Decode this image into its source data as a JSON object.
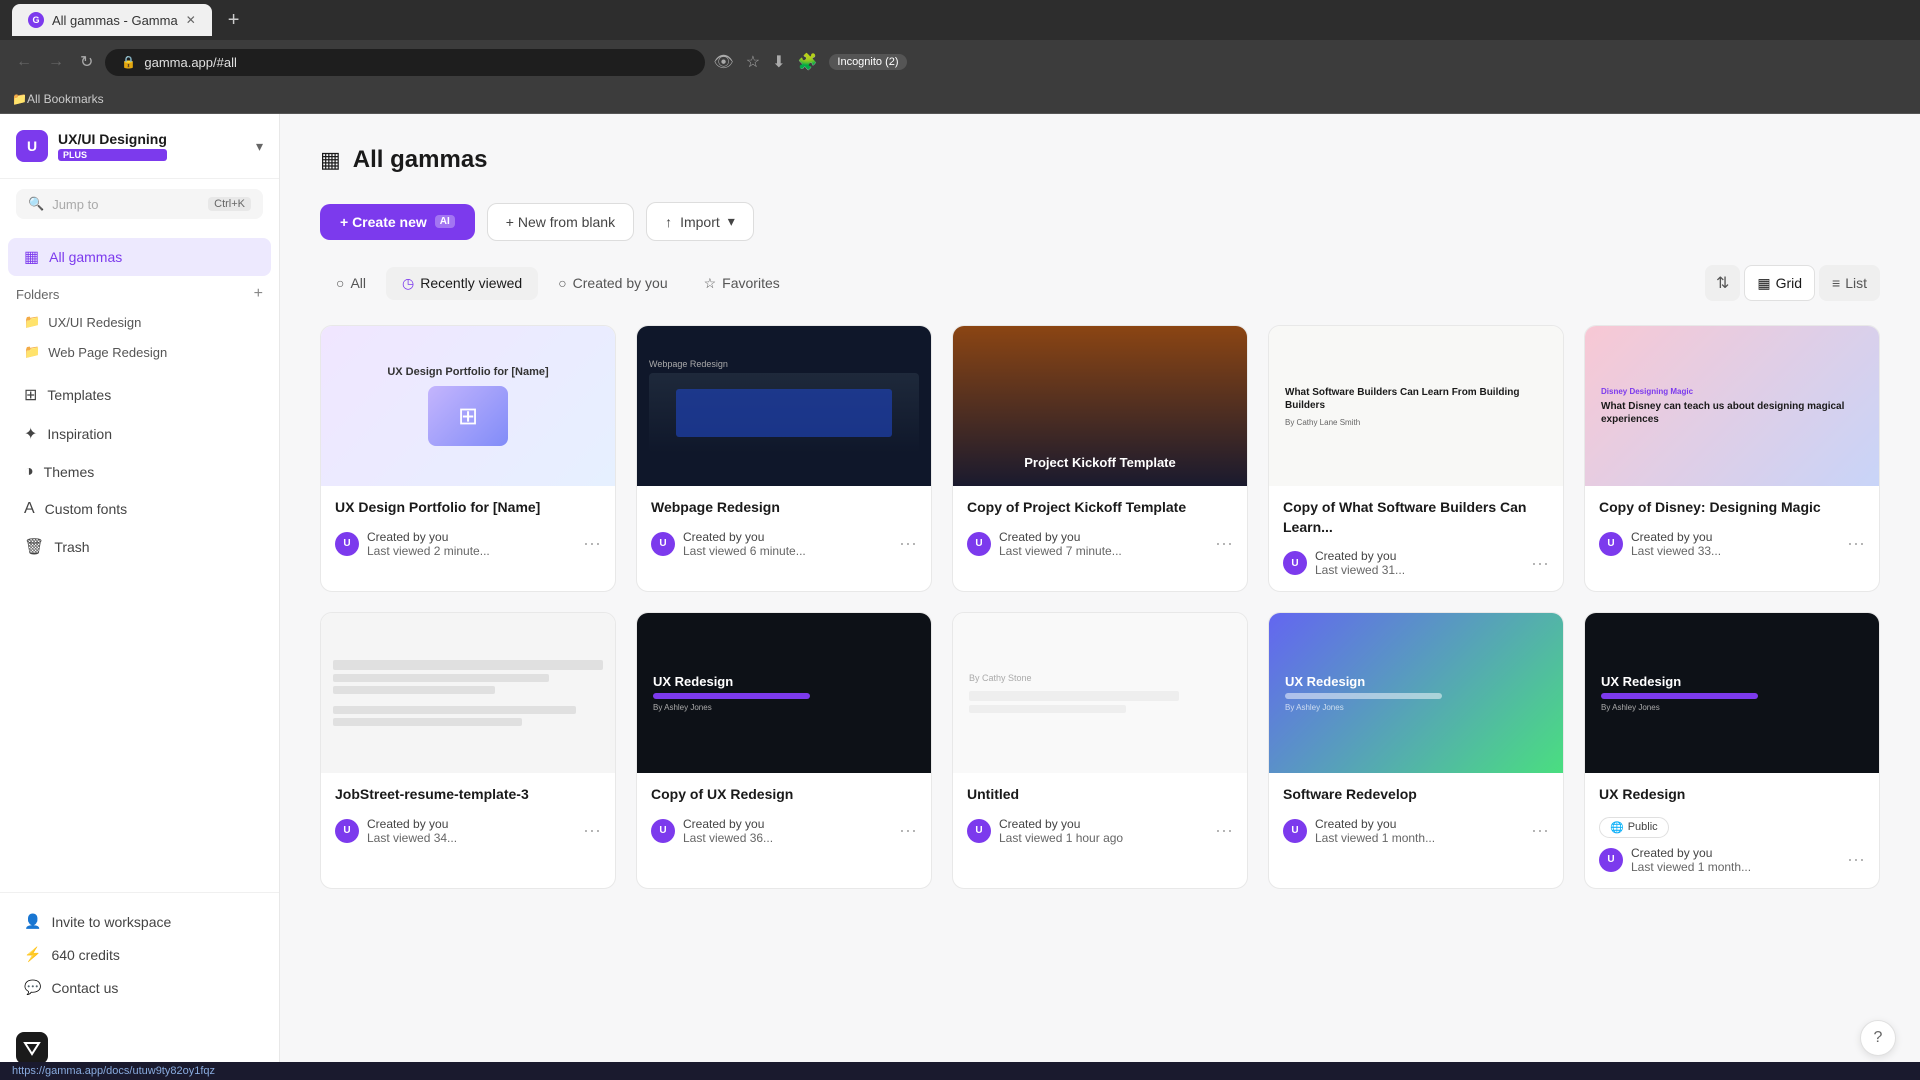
{
  "browser": {
    "tab_title": "All gammas - Gamma",
    "tab_favicon": "G",
    "address": "gamma.app/#all",
    "incognito_label": "Incognito (2)",
    "bookmarks_label": "All Bookmarks"
  },
  "sidebar": {
    "workspace_name": "UX/UI Designing",
    "workspace_initial": "U",
    "workspace_plan": "PLUS",
    "search_placeholder": "Jump to",
    "search_shortcut": "Ctrl+K",
    "nav_items": [
      {
        "label": "All gammas",
        "icon": "▦",
        "active": true
      },
      {
        "label": "Templates",
        "icon": "⊞",
        "active": false
      },
      {
        "label": "Inspiration",
        "icon": "✦",
        "active": false
      },
      {
        "label": "Themes",
        "icon": "◑",
        "active": false
      },
      {
        "label": "Custom fonts",
        "icon": "A",
        "active": false
      },
      {
        "label": "Trash",
        "icon": "🗑",
        "active": false
      }
    ],
    "folders_label": "Folders",
    "folders": [
      {
        "label": "UX/UI Redesign",
        "icon": "📁"
      },
      {
        "label": "Web Page Redesign",
        "icon": "📁"
      }
    ],
    "footer_items": [
      {
        "label": "Invite to workspace",
        "icon": "👤"
      },
      {
        "label": "640 credits",
        "icon": "⚡"
      },
      {
        "label": "Contact us",
        "icon": "💬"
      }
    ]
  },
  "main": {
    "page_title": "All gammas",
    "page_icon": "▦",
    "toolbar": {
      "create_label": "+ Create new",
      "create_ai": "AI",
      "blank_label": "+ New from blank",
      "import_label": "Import"
    },
    "filter_tabs": [
      {
        "label": "All",
        "icon": "○",
        "active": false
      },
      {
        "label": "Recently viewed",
        "icon": "◷",
        "active": true
      },
      {
        "label": "Created by you",
        "icon": "○",
        "active": false
      },
      {
        "label": "Favorites",
        "icon": "☆",
        "active": false
      }
    ],
    "view_controls": {
      "sort_icon": "⇅",
      "grid_label": "Grid",
      "list_label": "List"
    },
    "cards": [
      {
        "id": "ux-portfolio",
        "title": "UX Design Portfolio for [Name]",
        "thumb_style": "thumb-ux",
        "creator": "Created by you",
        "time": "Last viewed 2 minute...",
        "thumb_text": "UX Design Portfolio for [Name]"
      },
      {
        "id": "webpage-redesign",
        "title": "Webpage Redesign",
        "thumb_style": "thumb-webpage",
        "creator": "Created by you",
        "time": "Last viewed 6 minute...",
        "thumb_text": ""
      },
      {
        "id": "project-kickoff",
        "title": "Copy of Project Kickoff Template",
        "thumb_style": "thumb-kickoff",
        "creator": "Created by you",
        "time": "Last viewed 7 minute...",
        "thumb_text": "Project Kickoff Template"
      },
      {
        "id": "software-builders",
        "title": "Copy of What Software Builders Can Learn...",
        "thumb_style": "thumb-software",
        "creator": "Created by you",
        "time": "Last viewed 31...",
        "thumb_text": "What Software Builders Can Learn From Building Builders"
      },
      {
        "id": "disney",
        "title": "Copy of Disney: Designing Magic",
        "thumb_style": "thumb-disney",
        "creator": "Created by you",
        "time": "Last viewed 33...",
        "thumb_text": "What Disney can teach us about designing magical experiences"
      },
      {
        "id": "jobstreet",
        "title": "JobStreet-resume-template-3",
        "thumb_style": "thumb-jobstreet",
        "creator": "Created by you",
        "time": "Last viewed 34...",
        "thumb_text": ""
      },
      {
        "id": "ux-redesign-copy",
        "title": "Copy of UX Redesign",
        "thumb_style": "thumb-uxredesign",
        "creator": "Created by you",
        "time": "Last viewed 36...",
        "thumb_text": "UX Redesign"
      },
      {
        "id": "untitled",
        "title": "Untitled",
        "thumb_style": "thumb-untitled",
        "creator": "Created by you",
        "time": "Last viewed 1 hour ago",
        "thumb_text": ""
      },
      {
        "id": "software-redevelop",
        "title": "Software Redevelop",
        "thumb_style": "thumb-software2",
        "creator": "Created by you",
        "time": "Last viewed 1 month...",
        "thumb_text": "UX Redesign",
        "badge": null
      },
      {
        "id": "ux-redesign",
        "title": "UX Redesign",
        "thumb_style": "thumb-uxredesign2",
        "creator": "Created by you",
        "time": "Last viewed 1 month...",
        "thumb_text": "UX Redesign",
        "badge": "Public"
      }
    ]
  },
  "status_bar": {
    "url": "https://gamma.app/docs/utuw9ty82oy1fqz"
  },
  "help_btn": "?"
}
